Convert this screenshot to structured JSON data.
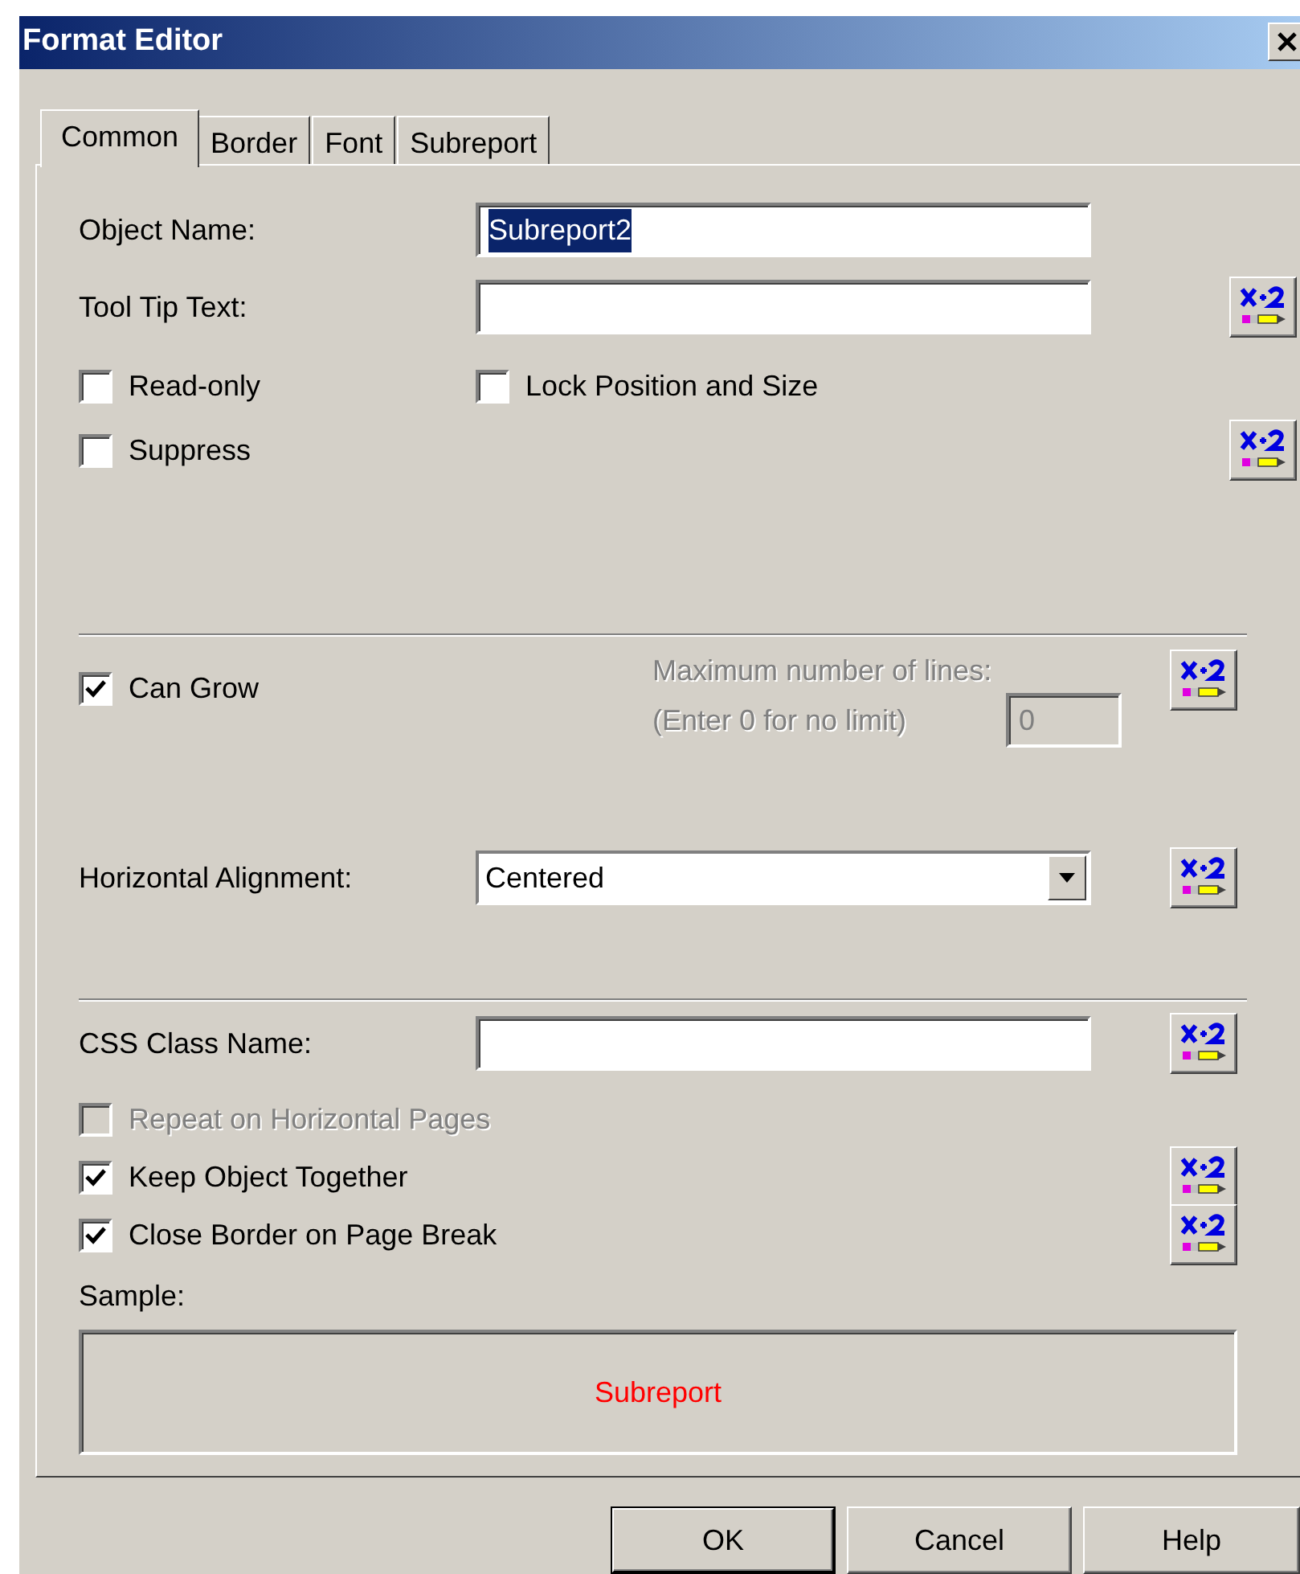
{
  "window": {
    "title": "Format Editor"
  },
  "tabs": [
    {
      "label": "Common",
      "selected": true
    },
    {
      "label": "Border",
      "selected": false
    },
    {
      "label": "Font",
      "selected": false
    },
    {
      "label": "Subreport",
      "selected": false
    }
  ],
  "sections": [
    {
      "rows": [
        {
          "kind": "text",
          "label": "Object Name:",
          "value": "Subreport2",
          "value_selected": true,
          "formula_button": false
        },
        {
          "kind": "text",
          "label": "Tool Tip Text:",
          "formula_button": true
        },
        {
          "kind": "checks",
          "checkboxes": [
            {
              "label": "Read-only",
              "checked": false,
              "disabled": false
            },
            {
              "label": "Lock Position and Size",
              "checked": false,
              "disabled": false
            }
          ],
          "formula_button": false
        },
        {
          "kind": "checks",
          "checkboxes": [
            {
              "label": "Suppress",
              "checked": false,
              "disabled": false
            }
          ],
          "formula_button": true
        }
      ]
    },
    {
      "rows": [
        {
          "kind": "grow",
          "checkbox": {
            "label": "Can Grow",
            "checked": true,
            "disabled": false
          },
          "max_label": "Maximum number of lines:",
          "max_hint": "(Enter 0 for no limit)",
          "max_value": "0",
          "max_disabled": true,
          "formula_button": true
        },
        {
          "kind": "dropdown",
          "label": "Horizontal Alignment:",
          "value": "Centered",
          "formula_button": true
        }
      ]
    },
    {
      "rows": [
        {
          "kind": "text",
          "label": "CSS Class Name:",
          "formula_button": true
        },
        {
          "kind": "checks",
          "checkboxes": [
            {
              "label": "Repeat on Horizontal Pages",
              "checked": false,
              "disabled": true
            }
          ],
          "formula_button": false
        },
        {
          "kind": "checks",
          "checkboxes": [
            {
              "label": "Keep Object Together",
              "checked": true,
              "disabled": false
            }
          ],
          "formula_button": true
        },
        {
          "kind": "checks",
          "checkboxes": [
            {
              "label": "Close Border on Page Break",
              "checked": true,
              "disabled": false
            }
          ],
          "formula_button": true
        }
      ],
      "sample": {
        "label": "Sample:",
        "text": "Subreport"
      }
    }
  ],
  "buttons": [
    {
      "label": "OK",
      "default": true
    },
    {
      "label": "Cancel",
      "default": false
    },
    {
      "label": "Help",
      "default": false
    }
  ]
}
